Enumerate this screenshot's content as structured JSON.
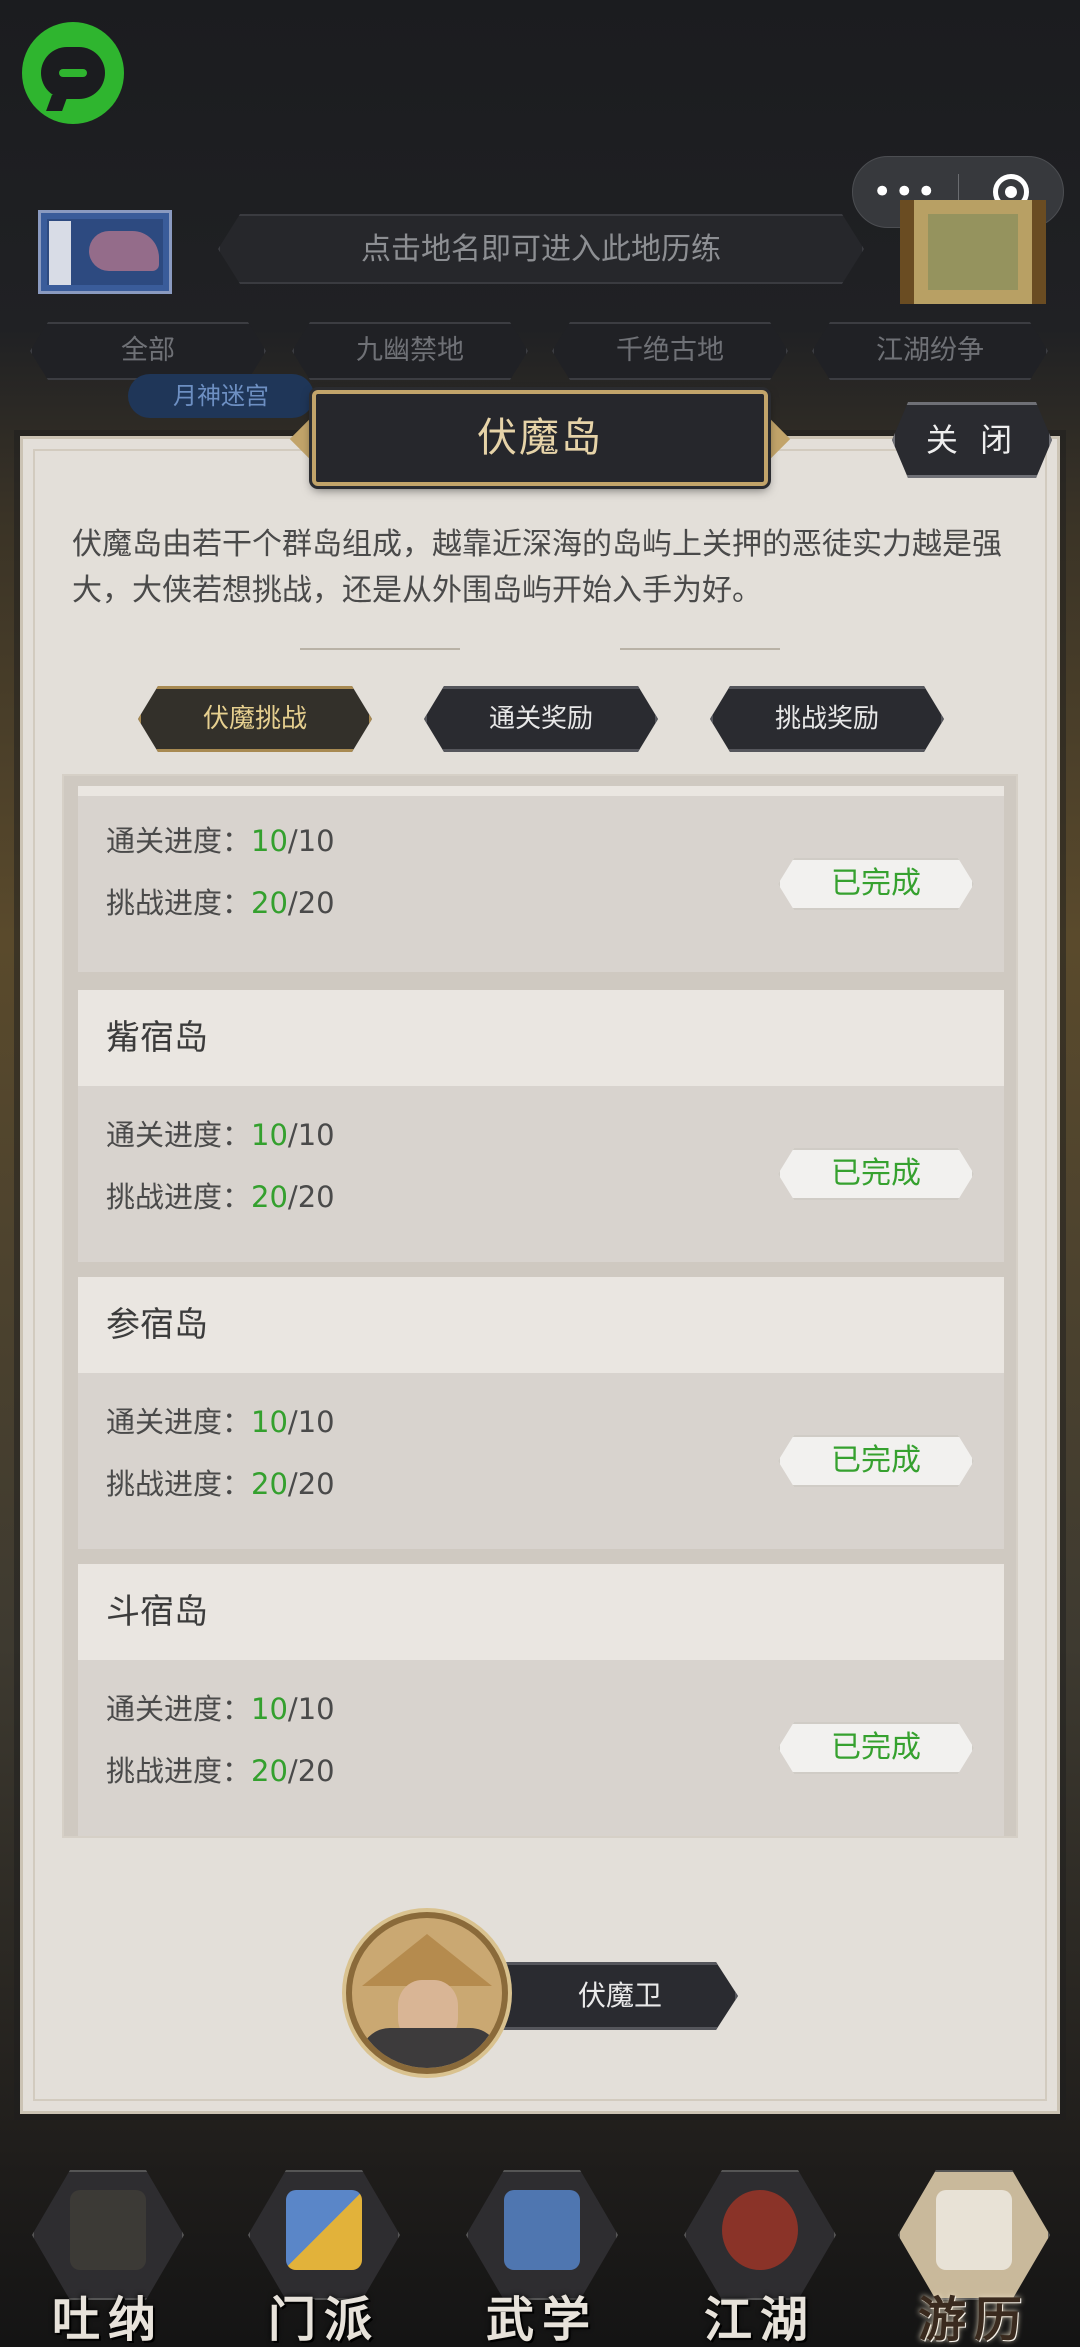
{
  "header": {
    "hint": "点击地名即可进入此地历练",
    "capsule_more": "•••"
  },
  "categories": [
    "全部",
    "九幽禁地",
    "千绝古地",
    "江湖纷争"
  ],
  "location_tag": "月神迷宫",
  "dialog": {
    "title": "伏魔岛",
    "close_label": "关 闭",
    "description": "伏魔岛由若干个群岛组成，越靠近深海的岛屿上关押的恶徒实力越是强大，大侠若想挑战，还是从外围岛屿开始入手为好。",
    "tabs": [
      "伏魔挑战",
      "通关奖励",
      "挑战奖励"
    ],
    "active_tab": "伏魔挑战"
  },
  "progress_labels": {
    "clear": "通关进度：",
    "challenge": "挑战进度："
  },
  "islands": [
    {
      "name": "",
      "clear_done": "10",
      "clear_total": "/10",
      "challenge_done": "20",
      "challenge_total": "/20",
      "status": "已完成"
    },
    {
      "name": "觜宿岛",
      "clear_done": "10",
      "clear_total": "/10",
      "challenge_done": "20",
      "challenge_total": "/20",
      "status": "已完成"
    },
    {
      "name": "参宿岛",
      "clear_done": "10",
      "clear_total": "/10",
      "challenge_done": "20",
      "challenge_total": "/20",
      "status": "已完成"
    },
    {
      "name": "斗宿岛",
      "clear_done": "10",
      "clear_total": "/10",
      "challenge_done": "20",
      "challenge_total": "/20",
      "status": "已完成"
    }
  ],
  "guard": {
    "label": "伏魔卫"
  },
  "bottom_nav": [
    {
      "label": "吐纳",
      "icon": "meditation-icon"
    },
    {
      "label": "门派",
      "icon": "sect-icon"
    },
    {
      "label": "武学",
      "icon": "martial-arts-icon"
    },
    {
      "label": "江湖",
      "icon": "jianghu-icon"
    },
    {
      "label": "游历",
      "icon": "travel-icon",
      "active": true
    }
  ],
  "colors": {
    "progress_green": "#34a02e",
    "gold": "#c2a46a",
    "panel_bg": "#e3dfd9"
  }
}
